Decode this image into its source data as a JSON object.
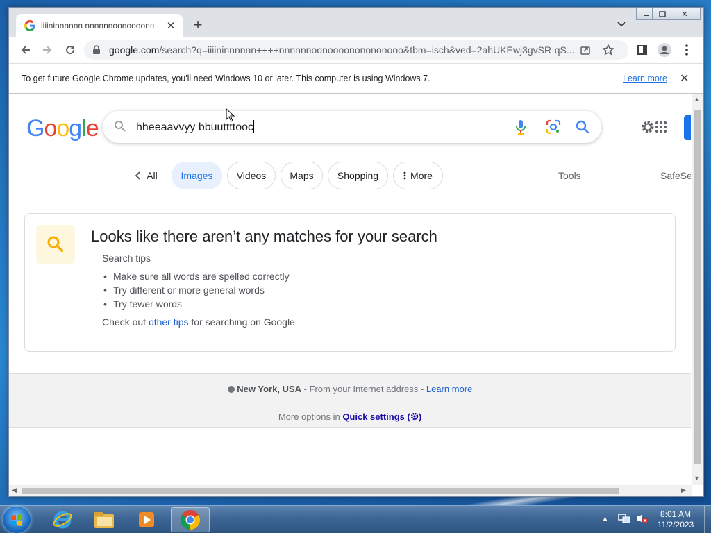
{
  "browser": {
    "tab_title": "iiiininnnnnn nnnnnnoonoooono",
    "new_tab": "+",
    "url_host": "google.com",
    "url_rest": "/search?q=iiiininnnnnn++++nnnnnnoonoooononononooo&tbm=isch&ved=2ahUKEwj3gvSR-qS...",
    "window_controls": [
      "minimize",
      "maximize",
      "close"
    ]
  },
  "infobar": {
    "message": "To get future Google Chrome updates, you'll need Windows 10 or later. This computer is using Windows 7.",
    "learn_more": "Learn more",
    "close": "✕"
  },
  "google": {
    "logo_letters": [
      "G",
      "o",
      "o",
      "g",
      "l",
      "e"
    ],
    "logo_colors": [
      "#4285f4",
      "#ea4335",
      "#fbbc05",
      "#4285f4",
      "#34a853",
      "#ea4335"
    ],
    "query": "hheeaavvyy  bbuuttttooc"
  },
  "chips": {
    "all": "All",
    "images": "Images",
    "videos": "Videos",
    "maps": "Maps",
    "shopping": "Shopping",
    "more": "More",
    "tools": "Tools",
    "safesearch": "SafeSe"
  },
  "no_results": {
    "heading": "Looks like there aren’t any matches for your search",
    "tips_title": "Search tips",
    "tips": [
      "Make sure all words are spelled correctly",
      "Try different or more general words",
      "Try fewer words"
    ],
    "checkout_prefix": "Check out ",
    "checkout_link": "other tips",
    "checkout_suffix": " for searching on Google"
  },
  "footer": {
    "location": "New York, USA",
    "location_suffix": " - From your Internet address - ",
    "learn_more": "Learn more",
    "options_prefix": "More options in ",
    "quick_settings": "Quick settings (",
    "quick_settings_end": ")"
  },
  "taskbar": {
    "apps": [
      "internet-explorer",
      "file-explorer",
      "media-player",
      "chrome"
    ],
    "time": "8:01 AM",
    "date": "11/2/2023"
  },
  "colors": {
    "accent": "#1a73e8",
    "chip_active_bg": "#e8f0fe"
  }
}
